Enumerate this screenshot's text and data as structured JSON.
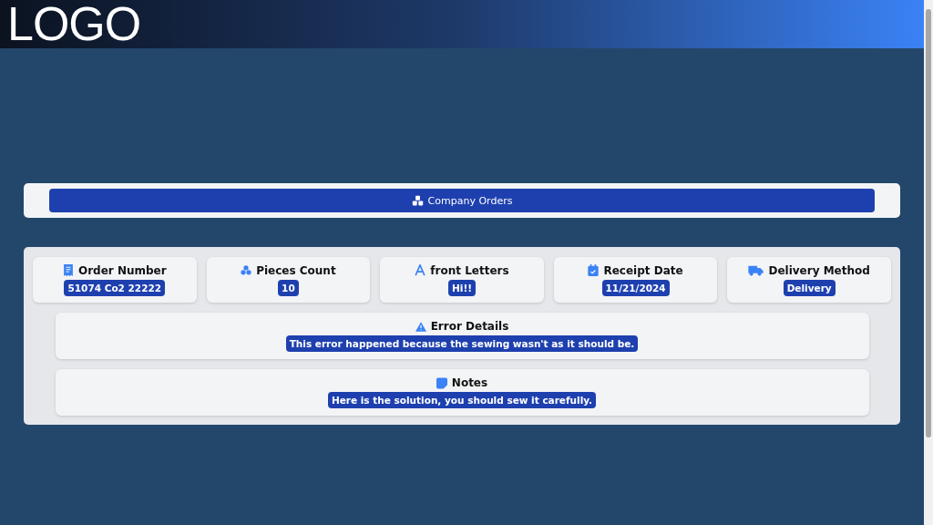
{
  "header": {
    "logo": "LOGO"
  },
  "orders_button": {
    "label": "Company Orders"
  },
  "fields": [
    {
      "kind": "receipt",
      "label": "Order Number",
      "value": "51074 Co2 22222"
    },
    {
      "kind": "pieces",
      "label": "Pieces Count",
      "value": "10"
    },
    {
      "kind": "letter",
      "label": "front Letters",
      "value": "Hi!!"
    },
    {
      "kind": "calendar",
      "label": "Receipt Date",
      "value": "11/21/2024"
    },
    {
      "kind": "truck",
      "label": "Delivery Method",
      "value": "Delivery"
    }
  ],
  "sections": [
    {
      "kind": "warning",
      "label": "Error Details",
      "value": "This error happened because the sewing wasn't as it should be."
    },
    {
      "kind": "note",
      "label": "Notes",
      "value": "Here is the solution, you should sew it carefully."
    }
  ]
}
